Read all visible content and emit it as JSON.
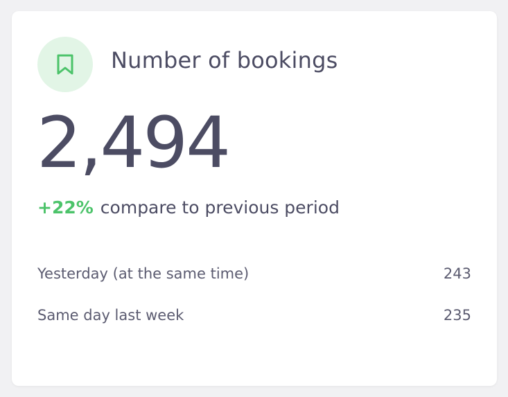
{
  "card": {
    "icon": "bookmark-icon",
    "title": "Number of bookings",
    "value": "2,494",
    "change": "+22%",
    "change_text": "compare to previous period",
    "rows": [
      {
        "label": "Yesterday (at the same time)",
        "value": "243"
      },
      {
        "label": "Same day last week",
        "value": "235"
      }
    ]
  },
  "colors": {
    "accent_green": "#4cc36a",
    "icon_bg": "#e2f5e6",
    "text_primary": "#4c4c63",
    "text_secondary": "#5b5b70",
    "page_bg": "#f1f1f3",
    "card_bg": "#ffffff"
  }
}
